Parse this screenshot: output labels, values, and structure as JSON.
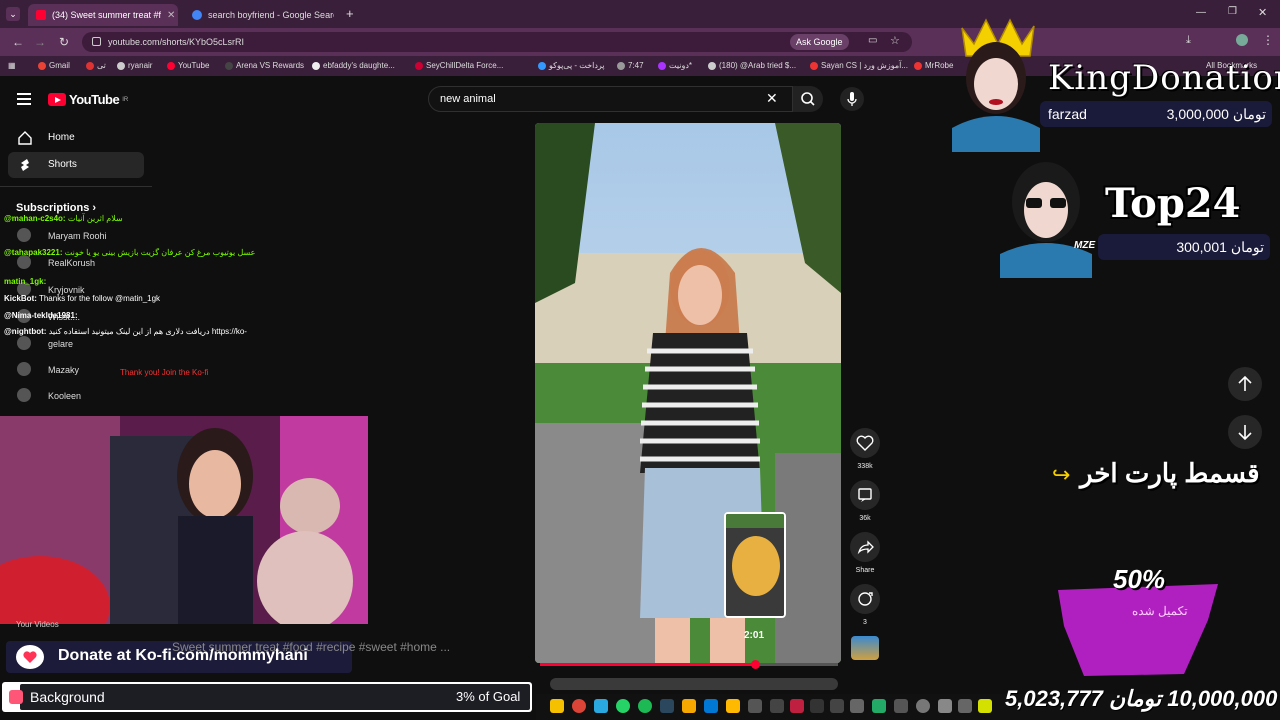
{
  "browser": {
    "tabs": [
      {
        "label": "(34) Sweet summer treat #f",
        "active": true
      },
      {
        "label": "search boyfriend - Google Searc",
        "active": false
      }
    ],
    "new_tab": "+",
    "url": "youtube.com/shorts/KYbO5cLsrRI",
    "ask_google": "Ask Google",
    "bookmarks": [
      "Gmail",
      "تی",
      "ryanair",
      "YouTube",
      "Arena VS Rewards",
      "ebfaddy's daughte...",
      "SeyChillDelta Force...",
      "پرداخت - پی‌پوکو",
      "7:47",
      "دونیت*",
      "(180) @Arab tried $...",
      "Sayan CS | آموزش ورد...",
      "MrRobe",
      "All Bookmarks"
    ]
  },
  "youtube": {
    "logo": "YouTube",
    "logo_sup": "IR",
    "search_value": "new animal",
    "sidebar": {
      "home": "Home",
      "shorts": "Shorts",
      "subscriptions_title": "Subscriptions",
      "subscriptions": [
        "Maryam Roohi",
        "RealKorush",
        "Kryjovnik",
        "Wisst....",
        "gelare",
        "Mazaky",
        "Kooleen"
      ],
      "your_videos": "Your Videos"
    },
    "short": {
      "title": "Sweet summer treat #food #recipe #sweet #home ...",
      "preview_time": "2:01",
      "progress": 0.72
    },
    "actions": {
      "likes": "338k",
      "comments": "36k",
      "share": "Share",
      "remix": "3"
    }
  },
  "chat": [
    {
      "user": "@mahan-c2s4o:",
      "text": "سلام اثرین آنیات",
      "color": "#7CFC00"
    },
    {
      "user": "@tahapak3221:",
      "text": "عسل یوتیوب مرغ کن عرفان گزیت بازیش بینی یو یا خونت",
      "color": "#7CFC00"
    },
    {
      "user": "matin_1gk:",
      "text": "",
      "color": "#7CFC00"
    },
    {
      "user": "KickBot:",
      "text": "Thanks for the follow @matin_1gk",
      "color": "#ffffff"
    },
    {
      "user": "@Nima-teklde1981:",
      "text": "",
      "color": "#ffffff"
    },
    {
      "user": "@nightbot:",
      "text": "دریافت دلاری هم از این لینک میتونید استفاده کنید https://ko-",
      "color": "#ffffff"
    },
    {
      "user": "",
      "text": "Thank you! Join the Ko-fi",
      "color": "#ff3030"
    }
  ],
  "overlay": {
    "king_title": "KingDonation",
    "king_name": "farzad",
    "king_amount": "3,000,000 تومان",
    "top_title": "Top24",
    "top_name": "MZE",
    "top_amount": "300,001 تومان",
    "part_text": "قسمط پارت اخر",
    "goal_percent": "50%",
    "goal_sub": "تکمیل شده",
    "goal_amount": "5,023,777 از 10,000,000 تومان",
    "kofi": "Donate at Ko-fi.com/mommyhani",
    "background_label": "Background",
    "background_goal": "3% of Goal",
    "background_progress": 0.03
  },
  "colors": {
    "tabbar": "#3a1f3a",
    "yt_red": "#ff0033",
    "goal_purple": "#b020c0"
  }
}
